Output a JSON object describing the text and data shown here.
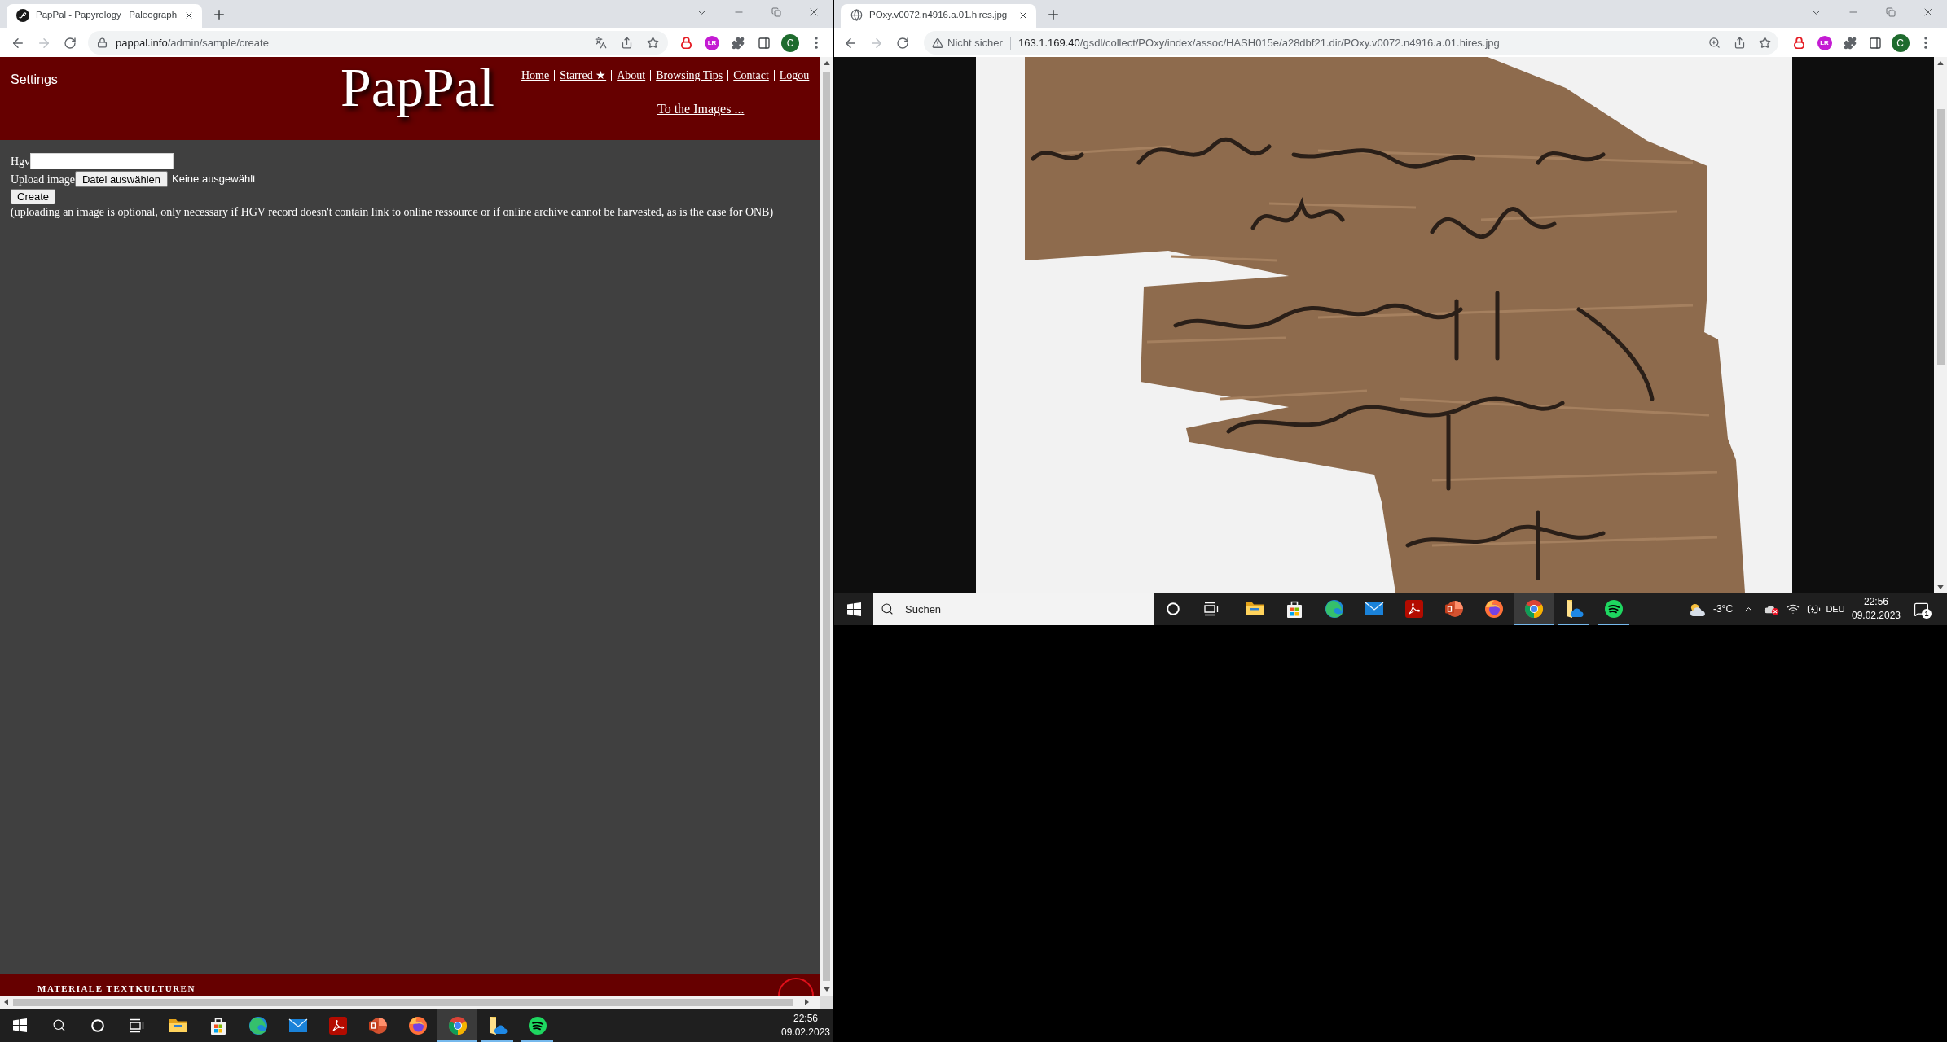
{
  "left_window": {
    "tabs": [
      {
        "title": "PapPal - Papyrology | Paleograph",
        "selected": true
      }
    ],
    "back": {
      "disabled": false
    },
    "forward": {
      "disabled": true
    },
    "address": {
      "host": "pappal.info",
      "path": "/admin/sample/create"
    },
    "extension_label": "LR",
    "profile_initial": "C"
  },
  "left_page": {
    "header": {
      "settings": "Settings",
      "logo": "PapPal",
      "nav": [
        "Home",
        "Starred ★",
        "About",
        "Browsing Tips",
        "Contact",
        "Logou"
      ],
      "images_link": "To the Images ..."
    },
    "form": {
      "hgv_label": "Hgv",
      "upload_label": "Upload image",
      "file_button": "Datei auswählen",
      "file_status": "Keine ausgewählt",
      "create_button": "Create",
      "note": "(uploading an image is optional, only necessary if HGV record doesn't contain link to online ressource or if online archive cannot be harvested, as is the case for ONB)"
    },
    "footer": {
      "title": "MATERIALE TEXTKULTUREN"
    }
  },
  "left_taskbar": {
    "apps": [
      {
        "kind": "explorer",
        "running": false,
        "selected": false
      },
      {
        "kind": "store",
        "running": false,
        "selected": false
      },
      {
        "kind": "edge",
        "running": false,
        "selected": false
      },
      {
        "kind": "mail",
        "running": false,
        "selected": false
      },
      {
        "kind": "acrobat",
        "running": false,
        "selected": false
      },
      {
        "kind": "powerpoint",
        "running": false,
        "selected": false
      },
      {
        "kind": "firefox",
        "running": false,
        "selected": false
      },
      {
        "kind": "chrome",
        "running": true,
        "selected": true
      },
      {
        "kind": "files",
        "running": true,
        "selected": false
      },
      {
        "kind": "spotify",
        "running": true,
        "selected": false
      }
    ],
    "time": "22:56",
    "date": "09.02.2023"
  },
  "right_window": {
    "tabs": [
      {
        "title": "POxy.v0072.n4916.a.01.hires.jpg",
        "selected": true
      }
    ],
    "back": {
      "disabled": false
    },
    "forward": {
      "disabled": true
    },
    "address": {
      "security": "Nicht sicher",
      "host": "163.1.169.40",
      "path": "/gsdl/collect/POxy/index/assoc/HASH015e/a28dbf21.dir/POxy.v0072.n4916.a.01.hires.jpg"
    },
    "extension_label": "LR",
    "profile_initial": "C"
  },
  "right_taskbar": {
    "search": {
      "placeholder": "Suchen"
    },
    "apps": [
      {
        "kind": "explorer",
        "running": false,
        "selected": false
      },
      {
        "kind": "store",
        "running": false,
        "selected": false
      },
      {
        "kind": "edge",
        "running": false,
        "selected": false
      },
      {
        "kind": "mail",
        "running": false,
        "selected": false
      },
      {
        "kind": "acrobat",
        "running": false,
        "selected": false
      },
      {
        "kind": "powerpoint",
        "running": false,
        "selected": false
      },
      {
        "kind": "firefox",
        "running": false,
        "selected": false
      },
      {
        "kind": "chrome",
        "running": true,
        "selected": true
      },
      {
        "kind": "files",
        "running": true,
        "selected": false
      },
      {
        "kind": "spotify",
        "running": true,
        "selected": false
      }
    ],
    "weather": "-3°C",
    "language": "DEU",
    "time": "22:56",
    "date": "09.02.2023",
    "notifications": "1"
  }
}
